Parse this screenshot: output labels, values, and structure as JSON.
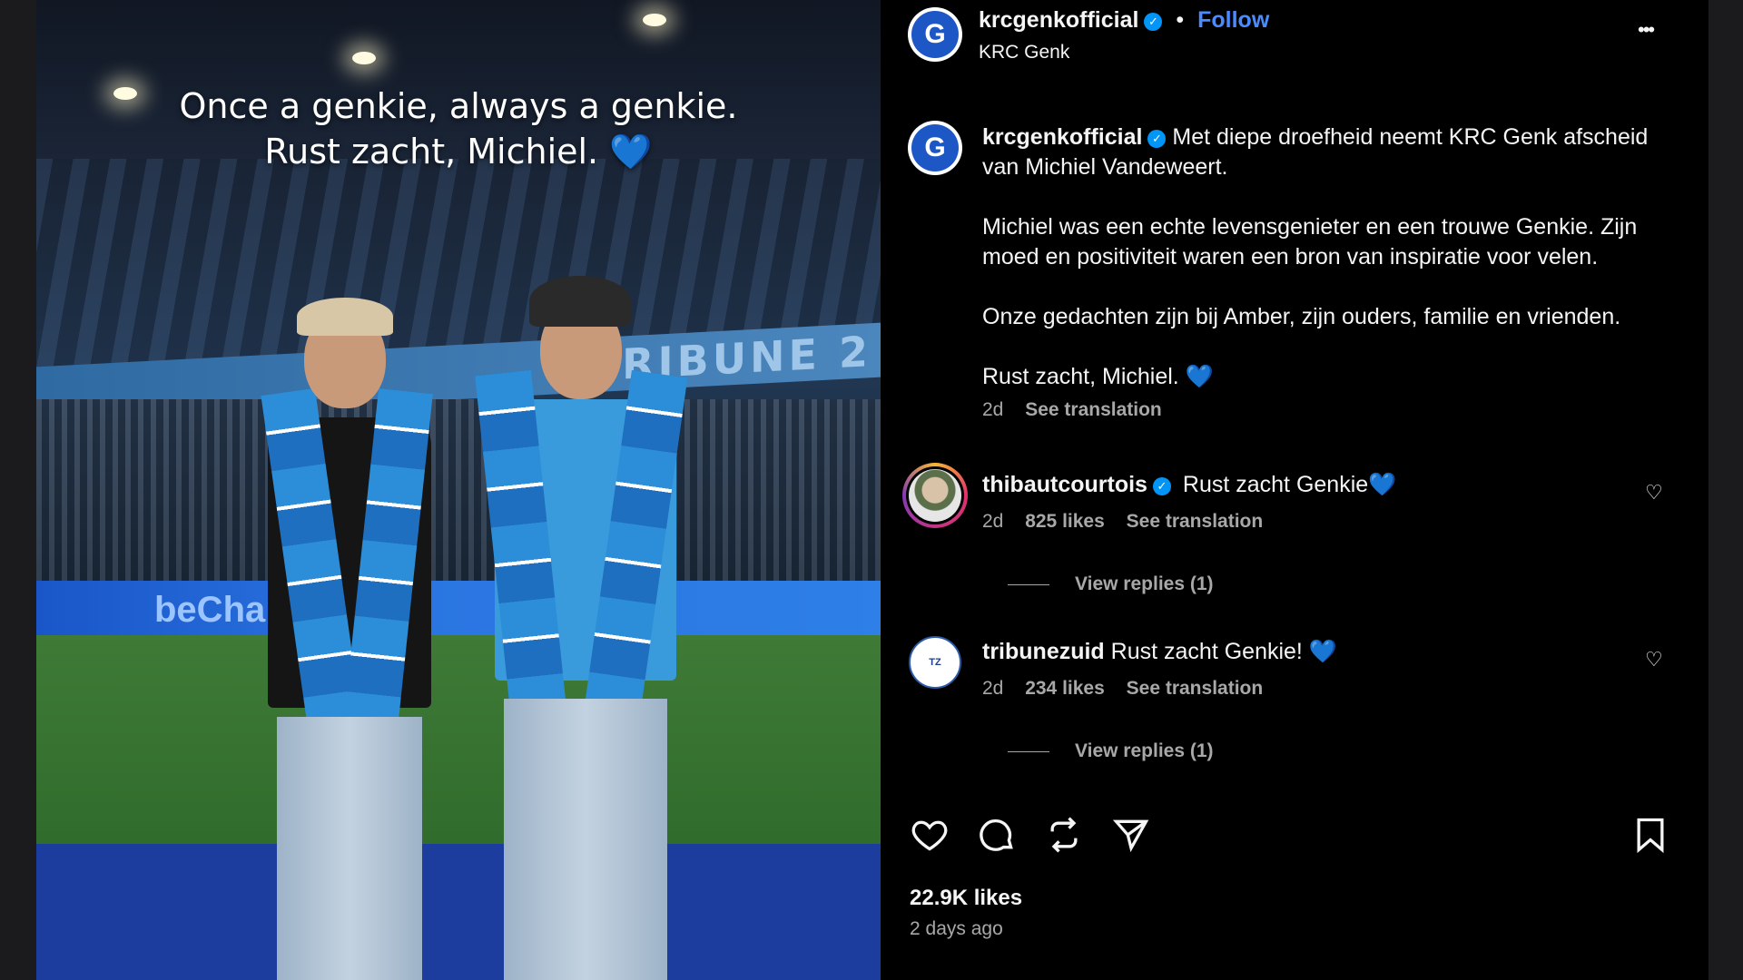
{
  "photo": {
    "caption_line1": "Once a genkie, always a genkie.",
    "caption_line2": "Rust zacht, Michiel.",
    "caption_heart": "💙",
    "banner_text": "TRIBUNE 2",
    "board_text": "beCharity"
  },
  "header": {
    "username": "krcgenkofficial",
    "separator": "•",
    "follow_label": "Follow",
    "subtitle": "KRC Genk",
    "more_label": "•••"
  },
  "post": {
    "username": "krcgenkofficial",
    "paragraph1": "Met diepe droefheid neemt KRC Genk afscheid van Michiel Vandeweert.",
    "paragraph2": "Michiel was een echte levensgenieter en een trouwe Genkie. Zijn moed en positiviteit waren een bron van inspiratie voor velen.",
    "paragraph3": "Onze gedachten zijn bij Amber, zijn ouders, familie en vrienden.",
    "paragraph4": "Rust zacht, Michiel.",
    "heart": "💙",
    "age": "2d",
    "translate_label": "See translation"
  },
  "comments": [
    {
      "username": "thibautcourtois",
      "text": "Rust zacht Genkie",
      "heart": "💙",
      "age": "2d",
      "likes": "825 likes",
      "translate_label": "See translation",
      "replies_label": "View replies (1)"
    },
    {
      "username": "tribunezuid",
      "text": "Rust zacht Genkie!",
      "heart": "💙",
      "age": "2d",
      "likes": "234 likes",
      "translate_label": "See translation",
      "replies_label": "View replies (1)"
    }
  ],
  "footer": {
    "likes": "22.9K likes",
    "time": "2 days ago"
  },
  "colors": {
    "accent_blue": "#0095f6",
    "follow_blue": "#4a8cff",
    "heart_blue": "#3b82f6"
  }
}
